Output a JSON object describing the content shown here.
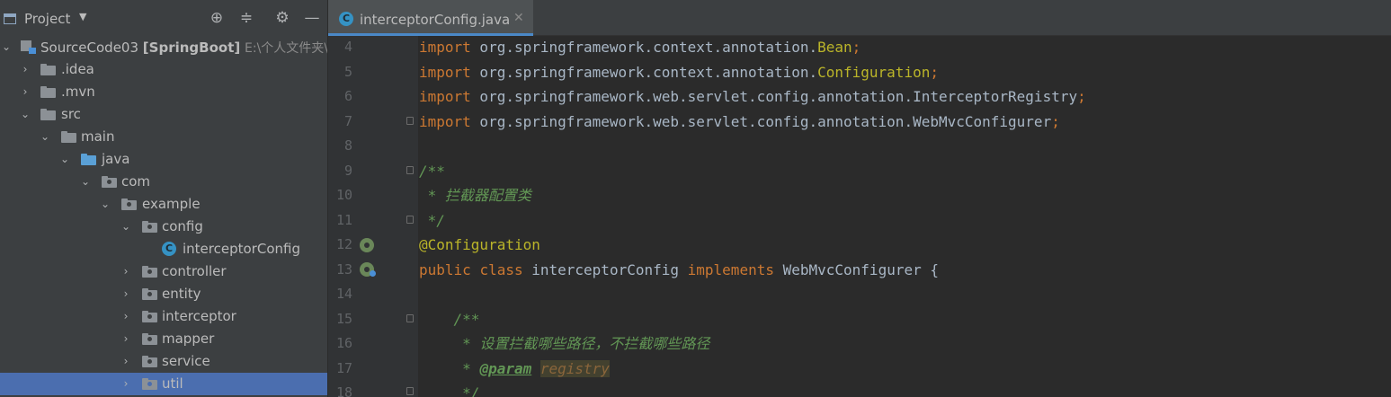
{
  "project_panel": {
    "title": "Project",
    "tree": [
      {
        "label": "SourceCode03",
        "bold": "[SpringBoot]",
        "path": "E:\\个人文件夹\\"
      },
      {
        "label": ".idea"
      },
      {
        "label": ".mvn"
      },
      {
        "label": "src"
      },
      {
        "label": "main"
      },
      {
        "label": "java"
      },
      {
        "label": "com"
      },
      {
        "label": "example"
      },
      {
        "label": "config"
      },
      {
        "label": "interceptorConfig"
      },
      {
        "label": "controller"
      },
      {
        "label": "entity"
      },
      {
        "label": "interceptor"
      },
      {
        "label": "mapper"
      },
      {
        "label": "service"
      },
      {
        "label": "util"
      }
    ],
    "selected_item": "util"
  },
  "editor": {
    "tab": {
      "label": "interceptorConfig.java",
      "close": "✕",
      "icon": "java-class-icon"
    },
    "line_numbers": [
      "4",
      "5",
      "6",
      "7",
      "8",
      "9",
      "10",
      "11",
      "12",
      "13",
      "14",
      "15",
      "16",
      "17",
      "18"
    ],
    "lines": {
      "l4": {
        "kw": "import",
        "text": " org.springframework.context.annotation.",
        "ident": "Bean",
        "end": ";"
      },
      "l5": {
        "kw": "import",
        "text": " org.springframework.context.annotation.",
        "ident": "Configuration",
        "end": ";"
      },
      "l6": {
        "kw": "import",
        "text": " org.springframework.web.servlet.config.annotation.InterceptorRegistry",
        "end": ";"
      },
      "l7": {
        "kw": "import",
        "text": " org.springframework.web.servlet.config.annotation.WebMvcConfigurer",
        "end": ";"
      },
      "l9": "/**",
      "l10": " * 拦截器配置类",
      "l11": " */",
      "l12": "@Configuration",
      "l13": {
        "kw1": "public",
        "kw2": "class",
        "name": " interceptorConfig ",
        "kw3": "implements",
        "rest": " WebMvcConfigurer {"
      },
      "l15": "    /**",
      "l16": "     * 设置拦截哪些路径，不拦截哪些路径",
      "l17": {
        "prefix": "     * ",
        "tag": "@param",
        "space": " ",
        "param": "registry"
      },
      "l18": "     */"
    }
  },
  "colors": {
    "keyword": "#cc7832",
    "annotation": "#bbb529",
    "comment": "#629755",
    "selection": "#4b6eaf"
  }
}
